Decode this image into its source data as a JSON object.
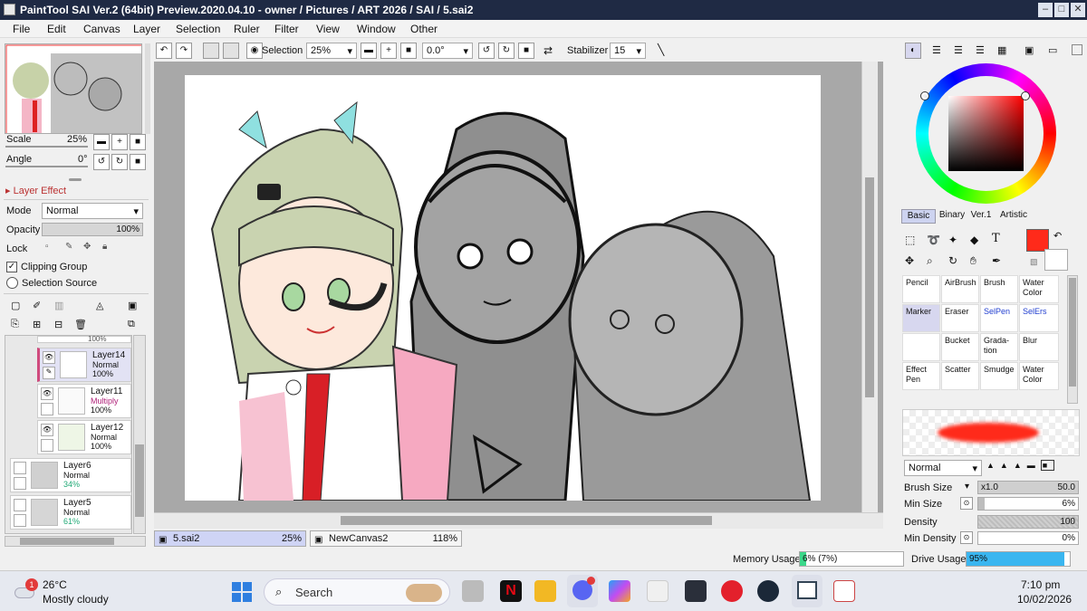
{
  "window": {
    "title": "PaintTool SAI Ver.2 (64bit) Preview.2020.04.10 - owner / Pictures / ART 2026 / SAI / 5.sai2",
    "controls": [
      "–",
      "□",
      "✕"
    ]
  },
  "menu": [
    "File",
    "Edit",
    "Canvas",
    "Layer",
    "Selection",
    "Ruler",
    "Filter",
    "View",
    "Window",
    "Other"
  ],
  "toolbar": {
    "selection_label": "Selection",
    "zoom_value": "25%",
    "angle_value": "0.0°",
    "stabilizer_label": "Stabilizer",
    "stabilizer_value": "15"
  },
  "navigator": {
    "scale_label": "Scale",
    "scale_value": "25%",
    "angle_label": "Angle",
    "angle_value": "0°"
  },
  "layer_effect": {
    "header": "Layer Effect",
    "mode_label": "Mode",
    "mode_value": "Normal",
    "opacity_label": "Opacity",
    "opacity_value": "100%",
    "lock_label": "Lock",
    "clipping_label": "Clipping Group",
    "selection_source_label": "Selection Source"
  },
  "layers": [
    {
      "name": "Layer14",
      "blend": "Normal",
      "opacity": "100%"
    },
    {
      "name": "Layer11",
      "blend": "Multiply",
      "opacity": "100%"
    },
    {
      "name": "Layer12",
      "blend": "Normal",
      "opacity": "100%"
    },
    {
      "name": "Layer6",
      "blend": "Normal",
      "opacity": "34%"
    },
    {
      "name": "Layer5",
      "blend": "Normal",
      "opacity": "61%"
    }
  ],
  "layer_top_partial": "100%",
  "color_panel": {
    "tabs": [
      "Basic",
      "Binary",
      "Ver.1",
      "Artistic"
    ],
    "primary_color": "#ff2a1a",
    "secondary_color": "#ffffff"
  },
  "tools": [
    {
      "name": "Pencil",
      "highlight": false,
      "blue": false
    },
    {
      "name": "AirBrush",
      "highlight": false,
      "blue": false
    },
    {
      "name": "Brush",
      "highlight": false,
      "blue": false
    },
    {
      "name": "Water Color",
      "highlight": false,
      "blue": false
    },
    {
      "name": "Marker",
      "highlight": true,
      "blue": false
    },
    {
      "name": "Eraser",
      "highlight": false,
      "blue": false
    },
    {
      "name": "SelPen",
      "highlight": false,
      "blue": true
    },
    {
      "name": "SelErs",
      "highlight": false,
      "blue": true
    },
    {
      "name": "",
      "highlight": false,
      "blue": false
    },
    {
      "name": "Bucket",
      "highlight": false,
      "blue": false
    },
    {
      "name": "Grada-tion",
      "highlight": false,
      "blue": false
    },
    {
      "name": "Blur",
      "highlight": false,
      "blue": false
    },
    {
      "name": "Effect Pen",
      "highlight": false,
      "blue": false
    },
    {
      "name": "Scatter",
      "highlight": false,
      "blue": false
    },
    {
      "name": "Smudge",
      "highlight": false,
      "blue": false
    },
    {
      "name": "Water Color",
      "highlight": false,
      "blue": false
    }
  ],
  "brush": {
    "blend_mode": "Normal",
    "size_label": "Brush Size",
    "size_multiplier": "x1.0",
    "size_value": "50.0",
    "min_size_label": "Min Size",
    "min_size_value": "6%",
    "density_label": "Density",
    "density_value": "100",
    "min_density_label": "Min Density",
    "min_density_value": "0%"
  },
  "documents": [
    {
      "name": "5.sai2",
      "zoom": "25%"
    },
    {
      "name": "NewCanvas2",
      "zoom": "118%"
    }
  ],
  "status": {
    "memory_label": "Memory Usage",
    "memory_value": "6% (7%)",
    "memory_percent": 6,
    "drive_label": "Drive Usage",
    "drive_value": "95%",
    "drive_percent": 95
  },
  "taskbar": {
    "weather_temp": "26°C",
    "weather_desc": "Mostly cloudy",
    "weather_badge": "1",
    "search_placeholder": "Search",
    "time": "7:10 pm",
    "date": "10/02/2026"
  }
}
